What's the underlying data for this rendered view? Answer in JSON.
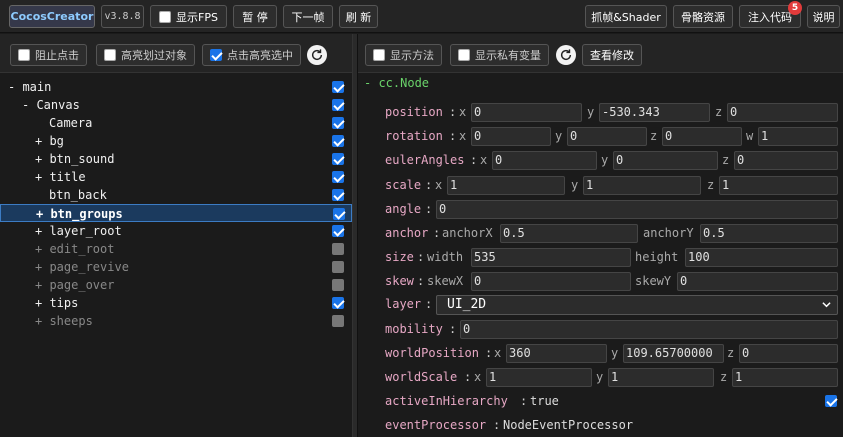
{
  "toolbar": {
    "brand": "CocosCreator",
    "version": "v3.8.8",
    "show_fps": "显示FPS",
    "pause": "暂 停",
    "next_frame": "下一帧",
    "refresh": "刷 新",
    "capture_shader": "抓帧&Shader",
    "bone_assets": "骨骼资源",
    "inject_code": "注入代码",
    "inject_badge": "5",
    "help": "说明"
  },
  "hierarchy_options": {
    "block_click": "阻止点击",
    "highlight_hover": "高亮划过对象",
    "click_highlight": "点击高亮选中"
  },
  "inspector_options": {
    "show_methods": "显示方法",
    "show_private": "显示私有变量",
    "view_changes": "查看修改"
  },
  "tree": [
    {
      "label": "- main",
      "indent": 0,
      "active": true,
      "checked": true
    },
    {
      "label": "- Canvas",
      "indent": 1,
      "active": true,
      "checked": true
    },
    {
      "label": "Camera",
      "indent": 3,
      "active": true,
      "checked": true
    },
    {
      "label": "+ bg",
      "indent": 2,
      "active": true,
      "checked": true
    },
    {
      "label": "+ btn_sound",
      "indent": 2,
      "active": true,
      "checked": true
    },
    {
      "label": "+ title",
      "indent": 2,
      "active": true,
      "checked": true
    },
    {
      "label": "btn_back",
      "indent": 3,
      "active": true,
      "checked": true
    },
    {
      "label": "+ btn_groups",
      "indent": 2,
      "active": true,
      "checked": true,
      "selected": true
    },
    {
      "label": "+ layer_root",
      "indent": 2,
      "active": true,
      "checked": true
    },
    {
      "label": "+ edit_root",
      "indent": 2,
      "active": false,
      "checked": false
    },
    {
      "label": "+ page_revive",
      "indent": 2,
      "active": false,
      "checked": false
    },
    {
      "label": "+ page_over",
      "indent": 2,
      "active": false,
      "checked": false
    },
    {
      "label": "+ tips",
      "indent": 2,
      "active": true,
      "checked": true
    },
    {
      "label": "+ sheeps",
      "indent": 2,
      "active": false,
      "checked": false
    }
  ],
  "inspector": {
    "component": "- cc.Node",
    "position": {
      "name": "position",
      "x": "0",
      "y": "-530.343",
      "z": "0"
    },
    "rotation": {
      "name": "rotation",
      "x": "0",
      "y": "0",
      "z": "0",
      "w": "1"
    },
    "euler": {
      "name": "eulerAngles",
      "x": "0",
      "y": "0",
      "z": "0"
    },
    "scale": {
      "name": "scale",
      "x": "1",
      "y": "1",
      "z": "1"
    },
    "angle": {
      "name": "angle",
      "value": "0"
    },
    "anchor": {
      "name": "anchor",
      "xl": "anchorX",
      "x": "0.5",
      "yl": "anchorY",
      "y": "0.5"
    },
    "size": {
      "name": "size",
      "wl": "width",
      "w": "535",
      "hl": "height",
      "h": "100"
    },
    "skew": {
      "name": "skew",
      "xl": "skewX",
      "x": "0",
      "yl": "skewY",
      "y": "0"
    },
    "layer": {
      "name": "layer",
      "value": "UI_2D"
    },
    "mobility": {
      "name": "mobility",
      "value": "0"
    },
    "world_position": {
      "name": "worldPosition",
      "x": "360",
      "y": "109.65700000",
      "z": "0"
    },
    "world_scale": {
      "name": "worldScale",
      "x": "1",
      "y": "1",
      "z": "1"
    },
    "active_in_hierarchy": {
      "name": "activeInHierarchy",
      "value": "true"
    },
    "event_processor": {
      "name": "eventProcessor",
      "value": "NodeEventProcessor"
    },
    "axis": {
      "x": "x",
      "y": "y",
      "z": "z",
      "w": "w"
    }
  },
  "colors": {
    "accent": "#1a74e8",
    "prop_name": "#e7a8c5",
    "component": "#6ad36a",
    "badge": "#e23b3b"
  }
}
